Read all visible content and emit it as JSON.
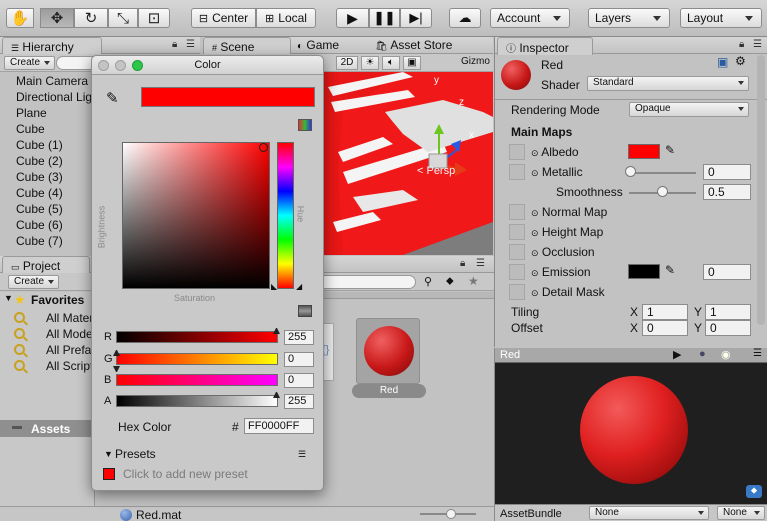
{
  "toolbar": {
    "pivot_label": "Center",
    "space_label": "Local",
    "account_label": "Account",
    "layers_label": "Layers",
    "layout_label": "Layout"
  },
  "hierarchy": {
    "title": "Hierarchy",
    "create_label": "Create",
    "items": [
      "Main Camera",
      "Directional Light",
      "Plane",
      "Cube",
      "Cube (1)",
      "Cube (2)",
      "Cube (3)",
      "Cube (4)",
      "Cube (5)",
      "Cube (6)",
      "Cube (7)"
    ]
  },
  "scene": {
    "tabs": [
      "Scene",
      "Game",
      "Asset Store"
    ],
    "mode_label": "2D",
    "gizmos_label": "Gizmo",
    "persp_label": "< Persp",
    "axes": [
      "y",
      "z",
      "x"
    ]
  },
  "project": {
    "title": "Project",
    "create_label": "Create",
    "favorites_label": "Favorites",
    "favorites": [
      "All Materials",
      "All Models",
      "All Prefabs",
      "All Scripts"
    ],
    "assets_label": "Assets",
    "asset_name": "Red",
    "footer_file": "Red.mat"
  },
  "inspector": {
    "title": "Inspector",
    "material_name": "Red",
    "shader_label": "Shader",
    "shader_value": "Standard",
    "rendering_mode_label": "Rendering Mode",
    "rendering_mode_value": "Opaque",
    "main_maps_label": "Main Maps",
    "albedo_label": "Albedo",
    "metallic_label": "Metallic",
    "metallic_value": "0",
    "smoothness_label": "Smoothness",
    "smoothness_value": "0.5",
    "normal_map_label": "Normal Map",
    "height_map_label": "Height Map",
    "occlusion_label": "Occlusion",
    "emission_label": "Emission",
    "emission_value": "0",
    "detail_mask_label": "Detail Mask",
    "tiling_label": "Tiling",
    "offset_label": "Offset",
    "x_label": "X",
    "y_label": "Y",
    "tiling_x": "1",
    "tiling_y": "1",
    "offset_x": "0",
    "offset_y": "0",
    "albedo_color": "#ff0000",
    "emission_color": "#000000"
  },
  "preview": {
    "title": "Red",
    "assetbundle_label": "AssetBundle",
    "bundle_value": "None",
    "variant_value": "None"
  },
  "color_picker": {
    "title": "Color",
    "brightness_label": "Brightness",
    "saturation_label": "Saturation",
    "hue_label": "Hue",
    "channels": [
      {
        "name": "R",
        "value": "255"
      },
      {
        "name": "G",
        "value": "0"
      },
      {
        "name": "B",
        "value": "0"
      },
      {
        "name": "A",
        "value": "255"
      }
    ],
    "hex_label": "Hex Color",
    "hex_hash": "#",
    "hex_value": "FF0000FF",
    "presets_label": "Presets",
    "add_preset_label": "Click to add new preset",
    "current_color": "#ff0000"
  }
}
